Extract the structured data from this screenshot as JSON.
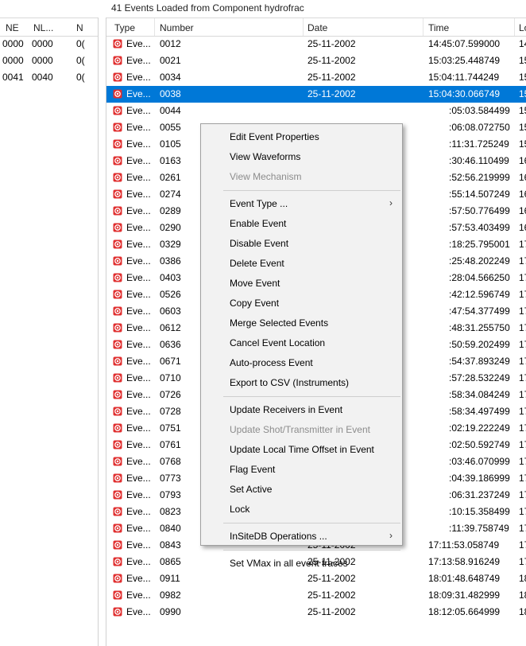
{
  "header_title": "41 Events Loaded from Component hydrofrac",
  "colors": {
    "selection": "#0078d7",
    "menu_bg": "#f2f2f2",
    "event_icon": "#e03030"
  },
  "left_table": {
    "columns": [
      "NE",
      "NL...",
      "N"
    ],
    "rows": [
      [
        "0000",
        "0000",
        "0("
      ],
      [
        "0000",
        "0000",
        "0("
      ],
      [
        "0041",
        "0040",
        "0("
      ]
    ]
  },
  "right_table": {
    "columns": [
      "Type",
      "Number",
      "Date",
      "Time",
      "Lo"
    ],
    "selected_index": 3,
    "rows": [
      {
        "type": "Eve...",
        "number": "0012",
        "date": "25-11-2002",
        "time": "14:45:07.599000",
        "lo": "14"
      },
      {
        "type": "Eve...",
        "number": "0021",
        "date": "25-11-2002",
        "time": "15:03:25.448749",
        "lo": "15"
      },
      {
        "type": "Eve...",
        "number": "0034",
        "date": "25-11-2002",
        "time": "15:04:11.744249",
        "lo": "15"
      },
      {
        "type": "Eve...",
        "number": "0038",
        "date": "25-11-2002",
        "time": "15:04:30.066749",
        "lo": "15"
      },
      {
        "type": "Eve...",
        "number": "0044",
        "date": "",
        "time": ":05:03.584499",
        "lo": "15"
      },
      {
        "type": "Eve...",
        "number": "0055",
        "date": "",
        "time": ":06:08.072750",
        "lo": "15"
      },
      {
        "type": "Eve...",
        "number": "0105",
        "date": "",
        "time": ":11:31.725249",
        "lo": "15"
      },
      {
        "type": "Eve...",
        "number": "0163",
        "date": "",
        "time": ":30:46.110499",
        "lo": "16"
      },
      {
        "type": "Eve...",
        "number": "0261",
        "date": "",
        "time": ":52:56.219999",
        "lo": "16"
      },
      {
        "type": "Eve...",
        "number": "0274",
        "date": "",
        "time": ":55:14.507249",
        "lo": "16"
      },
      {
        "type": "Eve...",
        "number": "0289",
        "date": "",
        "time": ":57:50.776499",
        "lo": "16"
      },
      {
        "type": "Eve...",
        "number": "0290",
        "date": "",
        "time": ":57:53.403499",
        "lo": "16"
      },
      {
        "type": "Eve...",
        "number": "0329",
        "date": "",
        "time": ":18:25.795001",
        "lo": "17"
      },
      {
        "type": "Eve...",
        "number": "0386",
        "date": "",
        "time": ":25:48.202249",
        "lo": "17"
      },
      {
        "type": "Eve...",
        "number": "0403",
        "date": "",
        "time": ":28:04.566250",
        "lo": "17"
      },
      {
        "type": "Eve...",
        "number": "0526",
        "date": "",
        "time": ":42:12.596749",
        "lo": "17"
      },
      {
        "type": "Eve...",
        "number": "0603",
        "date": "",
        "time": ":47:54.377499",
        "lo": "17"
      },
      {
        "type": "Eve...",
        "number": "0612",
        "date": "",
        "time": ":48:31.255750",
        "lo": "17"
      },
      {
        "type": "Eve...",
        "number": "0636",
        "date": "",
        "time": ":50:59.202499",
        "lo": "17"
      },
      {
        "type": "Eve...",
        "number": "0671",
        "date": "",
        "time": ":54:37.893249",
        "lo": "17"
      },
      {
        "type": "Eve...",
        "number": "0710",
        "date": "",
        "time": ":57:28.532249",
        "lo": "17"
      },
      {
        "type": "Eve...",
        "number": "0726",
        "date": "",
        "time": ":58:34.084249",
        "lo": "17"
      },
      {
        "type": "Eve...",
        "number": "0728",
        "date": "",
        "time": ":58:34.497499",
        "lo": "17"
      },
      {
        "type": "Eve...",
        "number": "0751",
        "date": "",
        "time": ":02:19.222249",
        "lo": "17"
      },
      {
        "type": "Eve...",
        "number": "0761",
        "date": "",
        "time": ":02:50.592749",
        "lo": "17"
      },
      {
        "type": "Eve...",
        "number": "0768",
        "date": "",
        "time": ":03:46.070999",
        "lo": "17"
      },
      {
        "type": "Eve...",
        "number": "0773",
        "date": "",
        "time": ":04:39.186999",
        "lo": "17"
      },
      {
        "type": "Eve...",
        "number": "0793",
        "date": "",
        "time": ":06:31.237249",
        "lo": "17"
      },
      {
        "type": "Eve...",
        "number": "0823",
        "date": "",
        "time": ":10:15.358499",
        "lo": "17"
      },
      {
        "type": "Eve...",
        "number": "0840",
        "date": "",
        "time": ":11:39.758749",
        "lo": "17"
      },
      {
        "type": "Eve...",
        "number": "0843",
        "date": "25-11-2002",
        "time": "17:11:53.058749",
        "lo": "17"
      },
      {
        "type": "Eve...",
        "number": "0865",
        "date": "25-11-2002",
        "time": "17:13:58.916249",
        "lo": "17"
      },
      {
        "type": "Eve...",
        "number": "0911",
        "date": "25-11-2002",
        "time": "18:01:48.648749",
        "lo": "18"
      },
      {
        "type": "Eve...",
        "number": "0982",
        "date": "25-11-2002",
        "time": "18:09:31.482999",
        "lo": "18"
      },
      {
        "type": "Eve...",
        "number": "0990",
        "date": "25-11-2002",
        "time": "18:12:05.664999",
        "lo": "18"
      }
    ]
  },
  "context_menu": {
    "items": [
      {
        "kind": "item",
        "label": "Edit Event Properties",
        "enabled": true
      },
      {
        "kind": "item",
        "label": "View Waveforms",
        "enabled": true
      },
      {
        "kind": "item",
        "label": "View Mechanism",
        "enabled": false
      },
      {
        "kind": "sep"
      },
      {
        "kind": "item",
        "label": "Event Type ...",
        "enabled": true,
        "submenu": true
      },
      {
        "kind": "item",
        "label": "Enable Event",
        "enabled": true
      },
      {
        "kind": "item",
        "label": "Disable Event",
        "enabled": true
      },
      {
        "kind": "item",
        "label": "Delete Event",
        "enabled": true
      },
      {
        "kind": "item",
        "label": "Move Event",
        "enabled": true
      },
      {
        "kind": "item",
        "label": "Copy Event",
        "enabled": true
      },
      {
        "kind": "item",
        "label": "Merge Selected Events",
        "enabled": true
      },
      {
        "kind": "item",
        "label": "Cancel Event Location",
        "enabled": true
      },
      {
        "kind": "item",
        "label": "Auto-process Event",
        "enabled": true
      },
      {
        "kind": "item",
        "label": "Export to CSV (Instruments)",
        "enabled": true
      },
      {
        "kind": "sep"
      },
      {
        "kind": "item",
        "label": "Update Receivers in Event",
        "enabled": true
      },
      {
        "kind": "item",
        "label": "Update Shot/Transmitter in Event",
        "enabled": false
      },
      {
        "kind": "item",
        "label": "Update Local Time Offset in Event",
        "enabled": true
      },
      {
        "kind": "item",
        "label": "Flag Event",
        "enabled": true
      },
      {
        "kind": "item",
        "label": "Set Active",
        "enabled": true
      },
      {
        "kind": "item",
        "label": "Lock",
        "enabled": true
      },
      {
        "kind": "sep"
      },
      {
        "kind": "item",
        "label": "InSiteDB Operations ...",
        "enabled": true,
        "submenu": true
      },
      {
        "kind": "sep"
      },
      {
        "kind": "item",
        "label": "Set VMax in all event traces",
        "enabled": true
      }
    ],
    "submenu_arrow": "›"
  }
}
